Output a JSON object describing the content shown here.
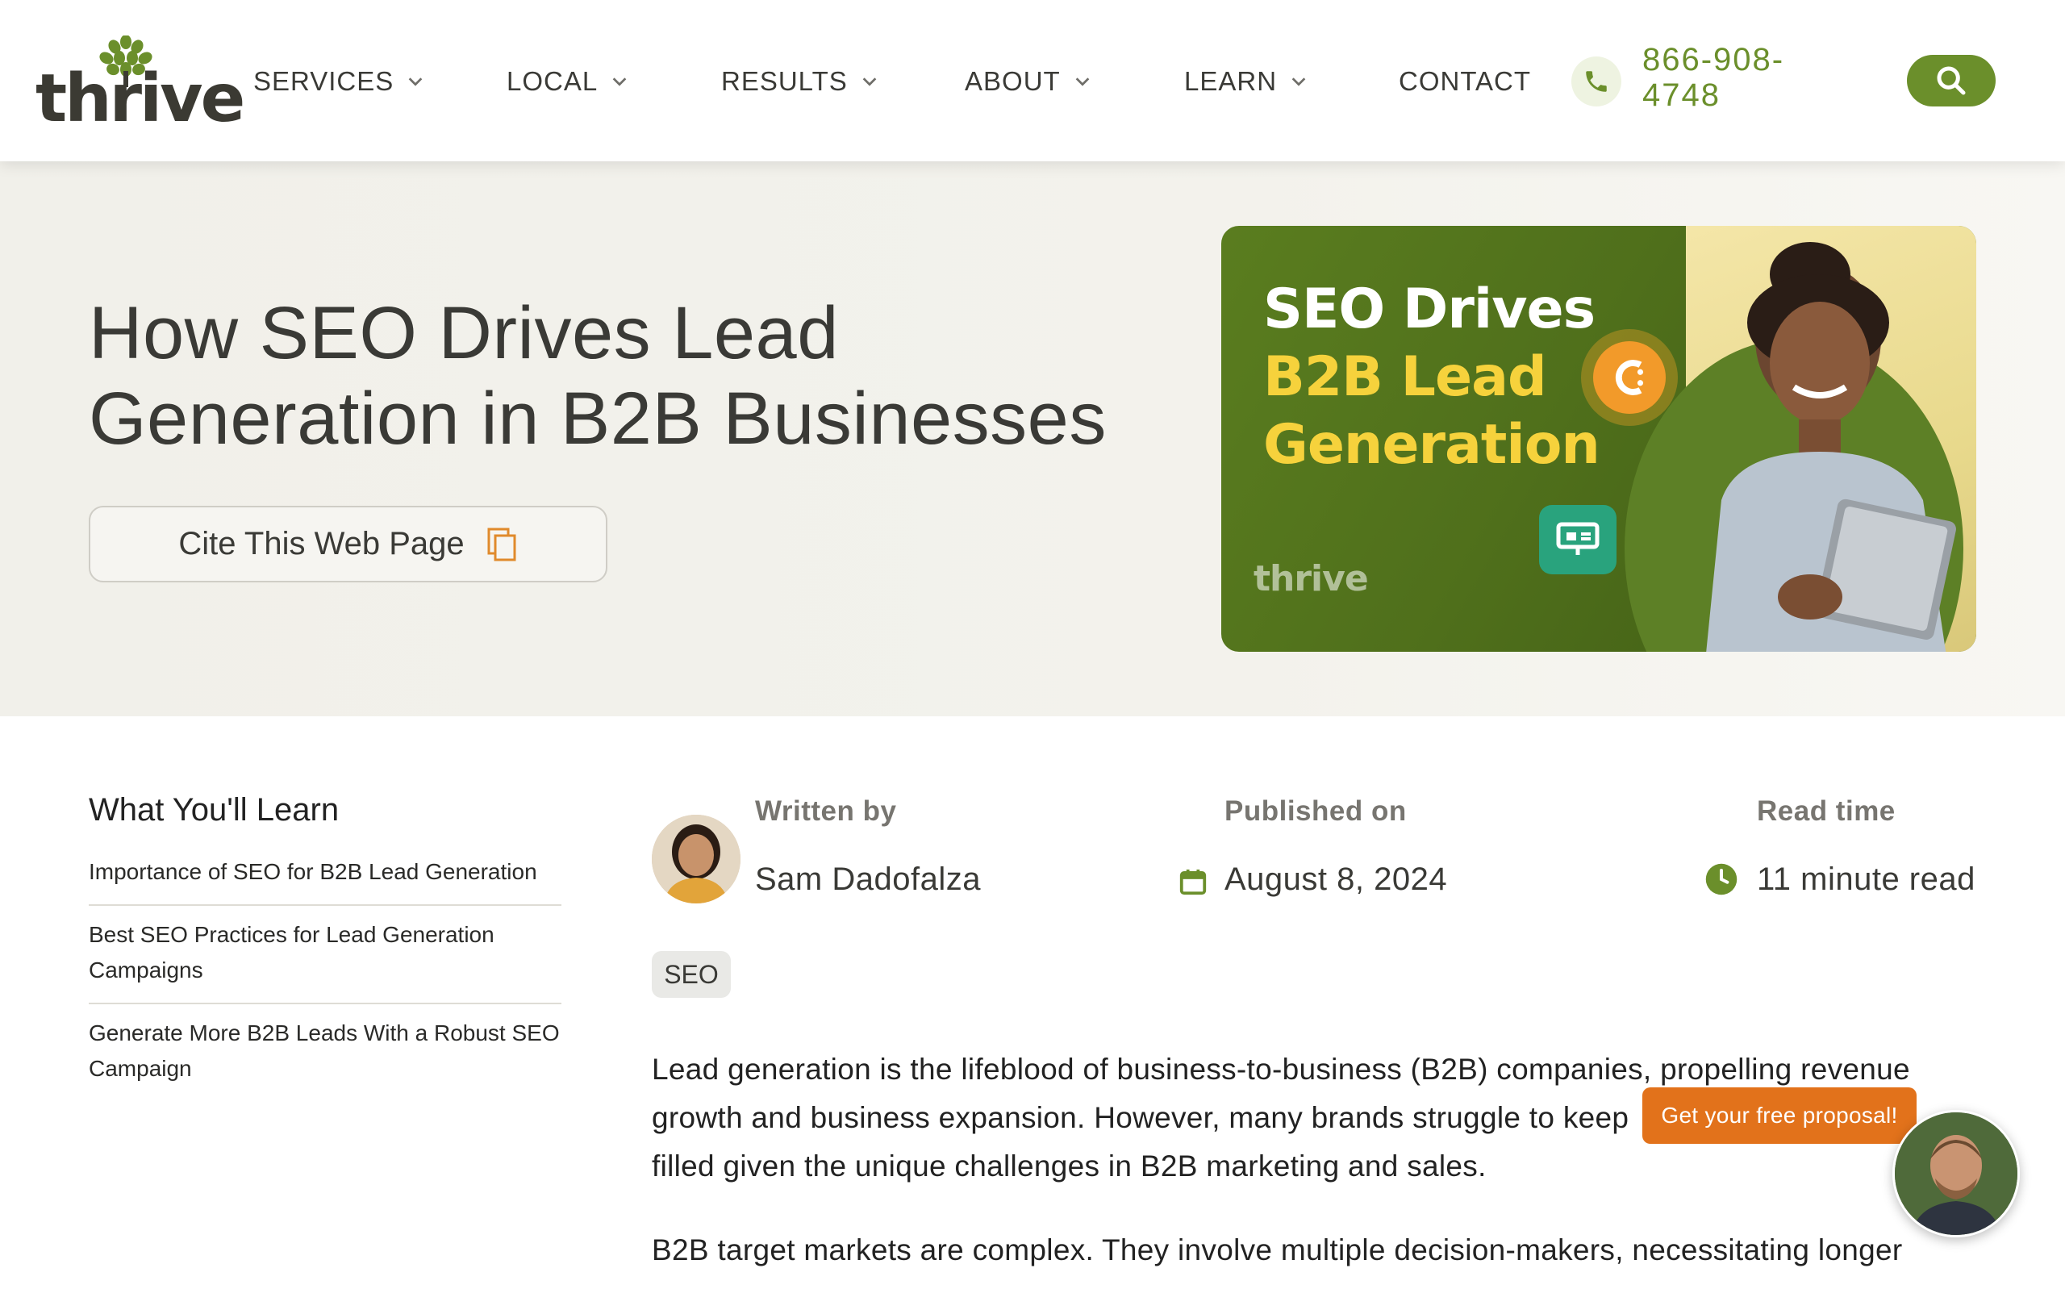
{
  "brand": {
    "logo_text": "thrive",
    "accent": "#6b8f2b",
    "cta_orange": "#e2721b"
  },
  "nav": {
    "items": [
      {
        "label": "SERVICES",
        "has_dropdown": true
      },
      {
        "label": "LOCAL",
        "has_dropdown": true
      },
      {
        "label": "RESULTS",
        "has_dropdown": true
      },
      {
        "label": "ABOUT",
        "has_dropdown": true
      },
      {
        "label": "LEARN",
        "has_dropdown": true
      },
      {
        "label": "CONTACT",
        "has_dropdown": false
      }
    ],
    "phone": "866-908-4748",
    "phone_icon": "phone-icon",
    "search_icon": "search-icon"
  },
  "hero": {
    "title_line1": "How SEO Drives Lead",
    "title_line2": "Generation in B2B Businesses",
    "cite_label": "Cite This Web Page",
    "cite_icon": "copy-icon",
    "image_text_line1": "SEO Drives",
    "image_text_line2": "B2B Lead",
    "image_text_line3": "Generation",
    "image_logo": "thrive"
  },
  "toc": {
    "title": "What You'll Learn",
    "items": [
      "Importance of SEO for B2B Lead Generation",
      "Best SEO Practices for Lead Generation Campaigns",
      "Generate More B2B Leads With a Robust SEO Campaign"
    ]
  },
  "meta": {
    "author_label": "Written by",
    "author_name": "Sam Dadofalza",
    "published_label": "Published on",
    "published_date": "August 8, 2024",
    "published_icon": "calendar-icon",
    "read_label": "Read time",
    "read_value": "11 minute read",
    "read_icon": "clock-icon",
    "tag": "SEO"
  },
  "article": {
    "p1_line1": "Lead generation is the lifeblood of business-to-business (B2B) companies, propelling revenue",
    "p1_line2": "growth and business expansion. However, many brands struggle to keep",
    "p1_line3": "filled given the unique challenges in B2B marketing and sales.",
    "p2_line1": "B2B target markets are complex. They involve multiple decision-makers, necessitating longer"
  },
  "chat": {
    "proposal_label": "Get your free proposal!"
  }
}
